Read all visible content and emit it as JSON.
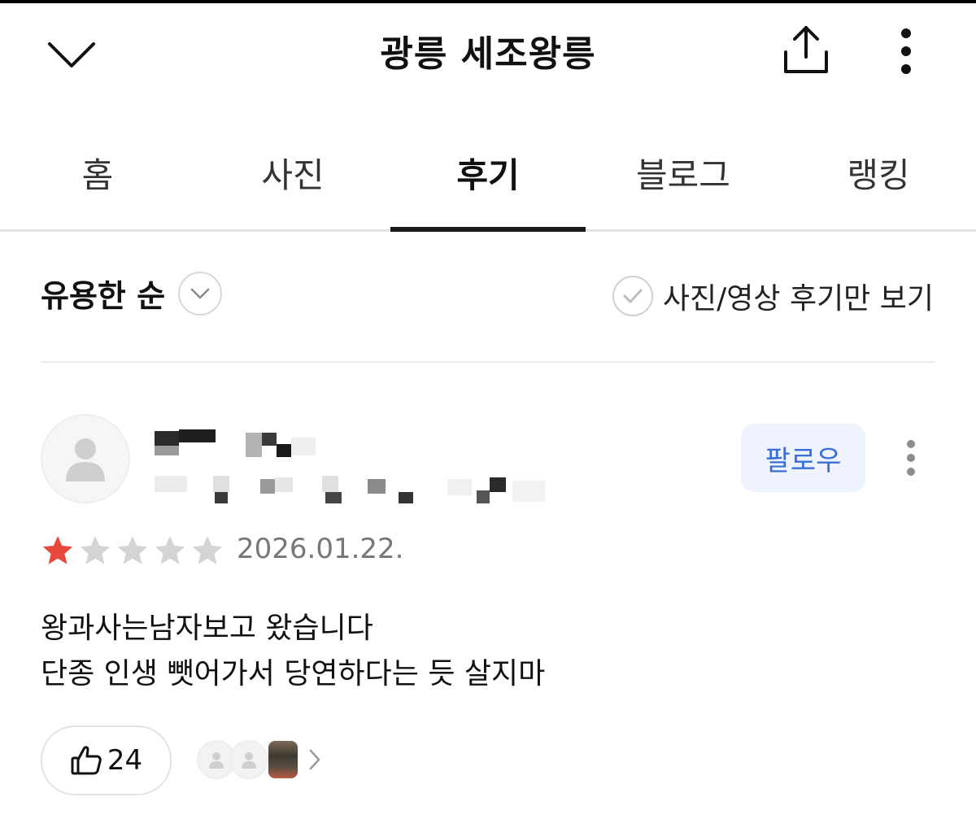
{
  "header": {
    "title": "광릉 세조왕릉",
    "back_icon": "chevron-down-icon",
    "share_icon": "share-icon",
    "more_icon": "more-vertical-icon"
  },
  "tabs": [
    {
      "label": "홈",
      "active": false
    },
    {
      "label": "사진",
      "active": false
    },
    {
      "label": "후기",
      "active": true
    },
    {
      "label": "블로그",
      "active": false
    },
    {
      "label": "랭킹",
      "active": false
    }
  ],
  "filters": {
    "sort_label": "유용한 순",
    "photo_only_label": "사진/영상 후기만 보기"
  },
  "review": {
    "follow_label": "팔로우",
    "rating": 1,
    "max_rating": 5,
    "date": "2026.01.22.",
    "text_lines": [
      "왕과사는남자보고 왔습니다",
      "단종 인생 뺏어가서 당연하다는 듯 살지마"
    ],
    "like_count": "24"
  },
  "colors": {
    "accent_blue": "#3a6fd8",
    "star_filled": "#e8473b",
    "star_empty": "#d4d4d4",
    "follow_bg": "#eef3fd"
  }
}
